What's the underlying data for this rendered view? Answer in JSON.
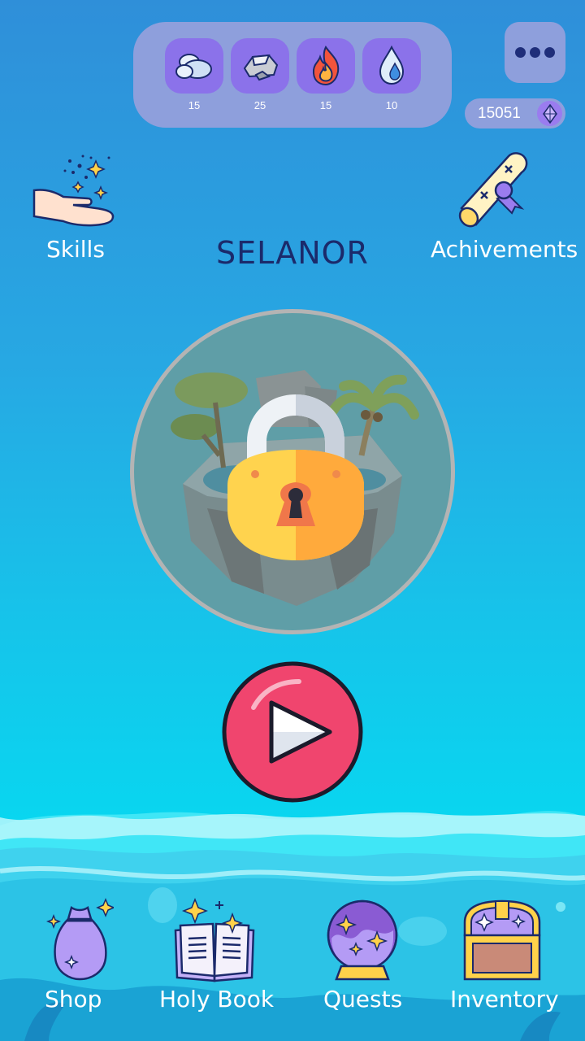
{
  "resources": [
    {
      "icon": "cloud-icon",
      "count": "15"
    },
    {
      "icon": "rock-icon",
      "count": "25"
    },
    {
      "icon": "fire-icon",
      "count": "15"
    },
    {
      "icon": "water-drop-icon",
      "count": "10"
    }
  ],
  "menu": {
    "icon": "more-dots-icon"
  },
  "currency": {
    "value": "15051",
    "icon": "crystal-gem-icon"
  },
  "skills": {
    "label": "Skills",
    "icon": "magic-hand-icon"
  },
  "achievements": {
    "label": "Achivements",
    "icon": "scroll-icon"
  },
  "world": {
    "name": "SELANOR",
    "locked": true,
    "icon": "padlock-icon"
  },
  "play": {
    "icon": "play-icon"
  },
  "nav": {
    "shop": "Shop",
    "holy_book": "Holy Book",
    "quests": "Quests",
    "inventory": "Inventory"
  },
  "colors": {
    "panel": "#8e9fdc",
    "tile": "#8b72ea",
    "title": "#1b2a6b",
    "play": "#f0456e"
  }
}
